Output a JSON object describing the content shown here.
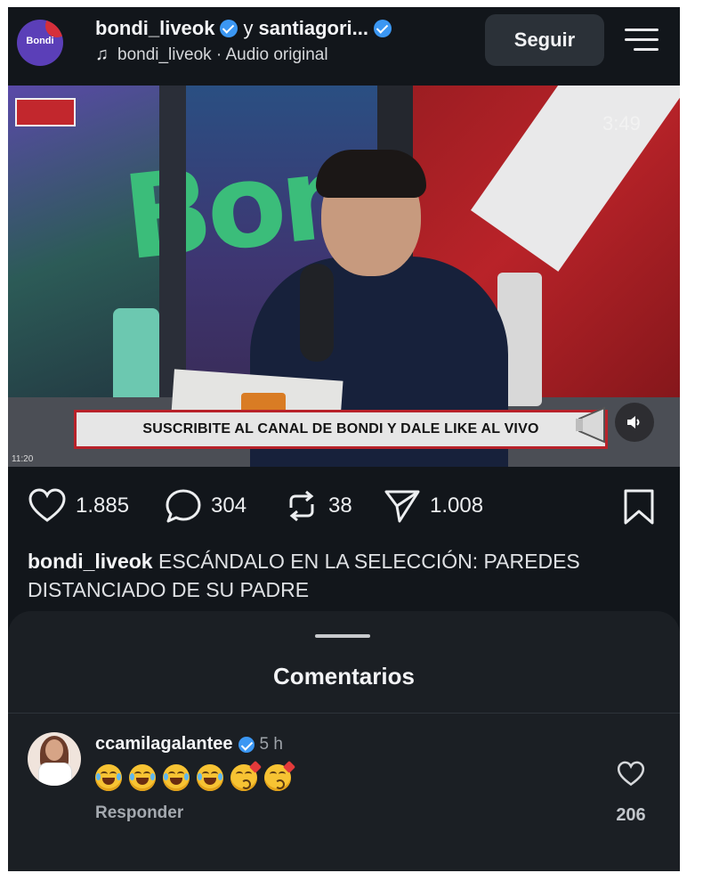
{
  "header": {
    "account": "bondi_liveok",
    "joiner": "y",
    "collaborator": "santiagori...",
    "audio_icon": "music-note-icon",
    "audio_label": "bondi_liveok · Audio original",
    "follow_label": "Seguir",
    "avatar_text": "Bondi"
  },
  "video": {
    "live_badge": "",
    "timer": "3:49",
    "banner_text": "SUSCRIBITE AL CANAL DE BONDI Y DALE LIKE AL VIVO",
    "small_time": "11:20",
    "logo_text": "Bon"
  },
  "actions": {
    "likes": "1.885",
    "comments": "304",
    "reposts": "38",
    "shares": "1.008"
  },
  "caption": {
    "user": "bondi_liveok",
    "text": "ESCÁNDALO EN LA SELECCIÓN: PAREDES DISTANCIADO DE SU PADRE"
  },
  "comments": {
    "title": "Comentarios",
    "items": [
      {
        "user": "ccamilagalantee",
        "time": "5 h",
        "emojis": [
          "tears-of-joy",
          "tears-of-joy",
          "tears-of-joy",
          "tears-of-joy",
          "face-blowing-kiss",
          "face-blowing-kiss"
        ],
        "reply_label": "Responder",
        "likes": "206"
      }
    ]
  },
  "colors": {
    "background": "#12161b",
    "sheet": "#1b1f24",
    "verified": "#3b97f3",
    "accent_red": "#c2272d"
  }
}
